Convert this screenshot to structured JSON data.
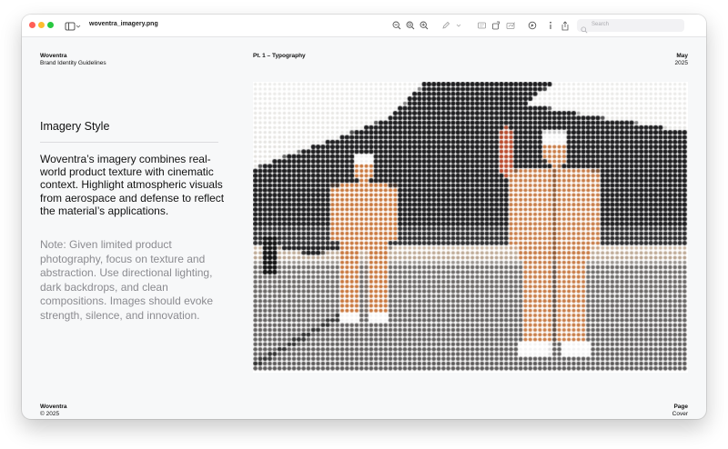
{
  "window": {
    "title": "woventra_imagery.png",
    "search_placeholder": "Search"
  },
  "header": {
    "brand": "Woventra",
    "subtitle": "Brand Identity Guidelines",
    "section": "Pt. 1 – Typography",
    "month": "May",
    "year": "2025"
  },
  "main": {
    "heading": "Imagery Style",
    "body": "Woventra’s imagery combines real-world product texture with cinematic context. Highlight atmospheric visuals from aerospace and defense to reflect the material’s applications.",
    "note": "Note: Given limited product photography, focus on texture and abstraction. Use directional lighting, dark backdrops, and clean compositions. Images should evoke strength, silence, and innovation."
  },
  "footer": {
    "brand": "Woventra",
    "copyright": "© 2025",
    "page_label": "Page",
    "page_value": "Cover"
  },
  "icons": [
    "sidebar-toggle-icon",
    "zoom-out-icon",
    "zoom-fit-icon",
    "zoom-in-icon",
    "markup-pen-icon",
    "chevron-down-icon",
    "crop-icon",
    "rotate-icon",
    "sign-icon",
    "markup-circle-icon",
    "info-icon",
    "share-icon",
    "search-icon"
  ],
  "colors": {
    "close": "#ff5f57",
    "minimize": "#febc2e",
    "zoom": "#28c840",
    "suit_orange": "#c8753a",
    "jet_dark": "#1c1c1e",
    "note_gray": "#8b8b90"
  }
}
